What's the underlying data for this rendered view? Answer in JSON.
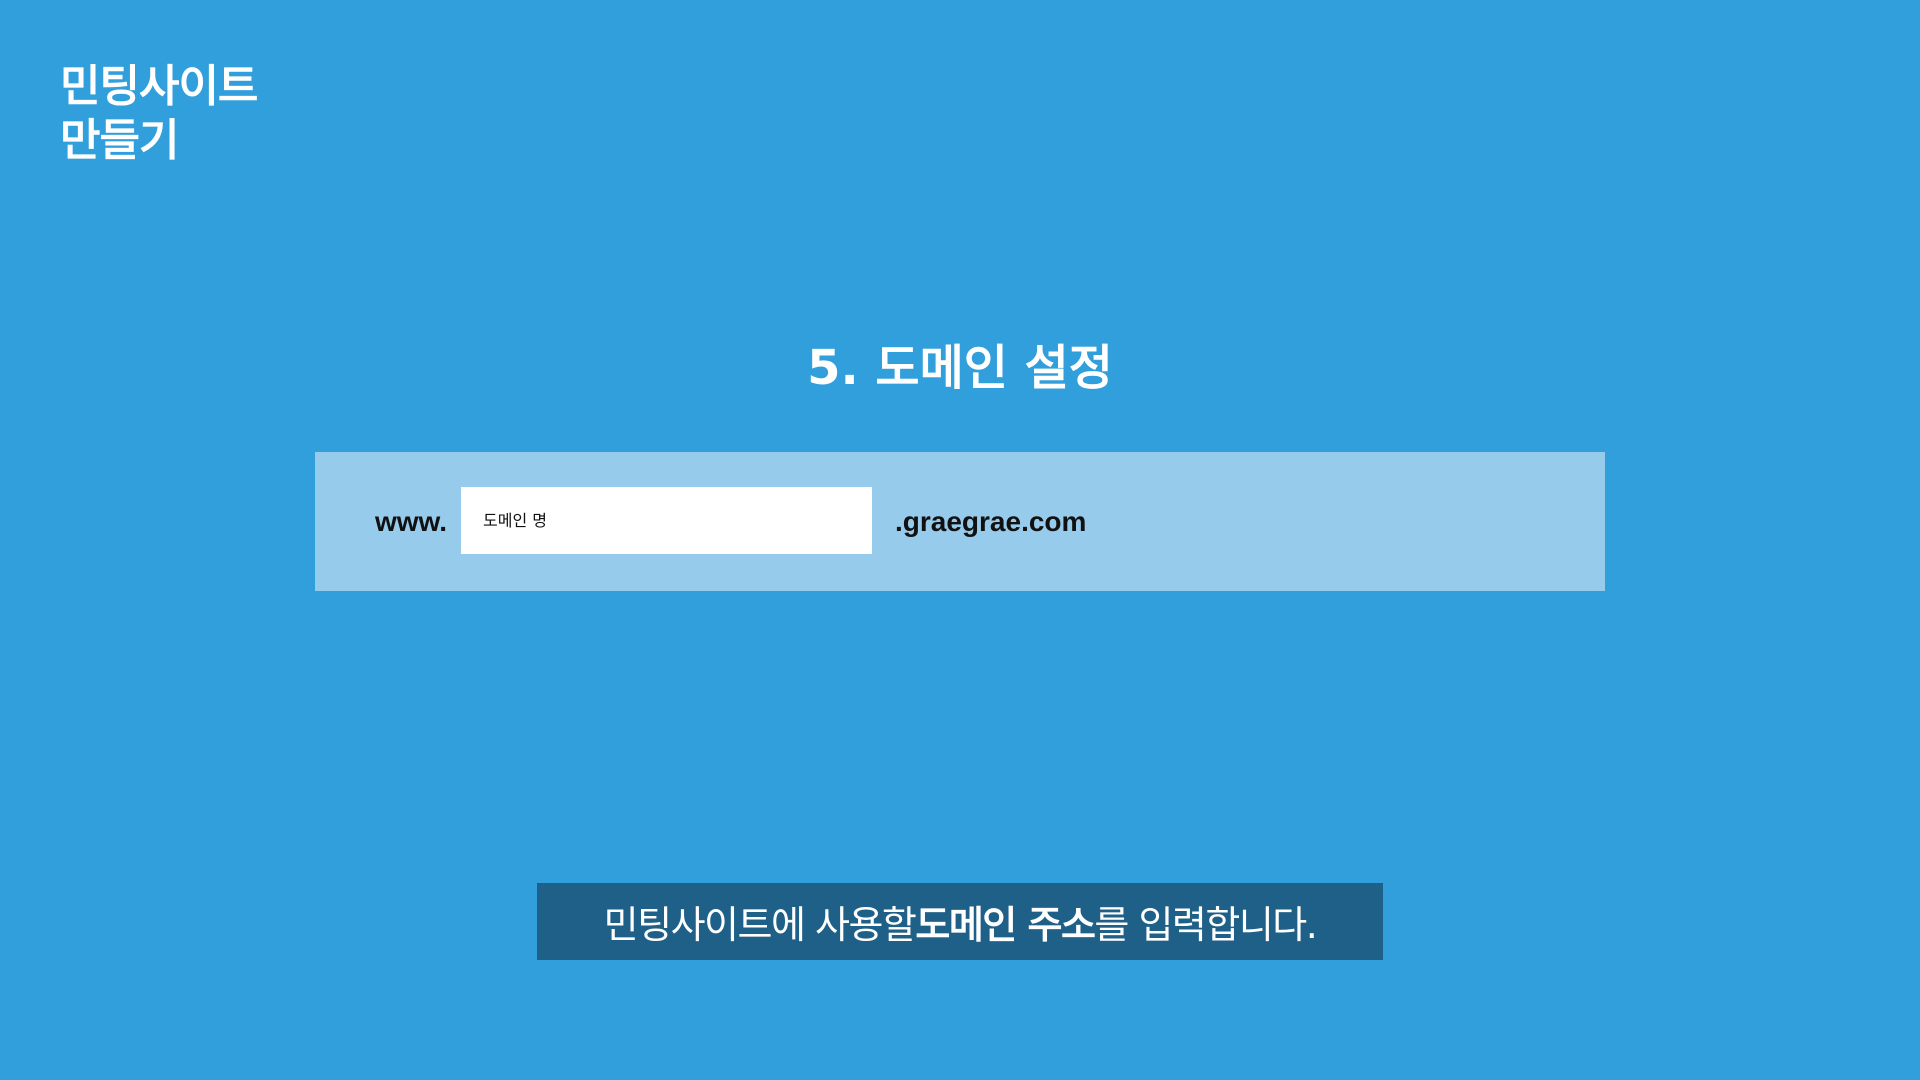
{
  "logo": {
    "line1": "민팅사이트",
    "line2": "만들기"
  },
  "step_title": "5. 도메인 설정",
  "domain_form": {
    "prefix": "www.",
    "input_placeholder": "도메인 명",
    "input_value": "",
    "suffix": ".graegrae.com"
  },
  "caption": {
    "part1": "민팅사이트에 사용할 ",
    "emphasis": "도메인 주소",
    "part2": "를 입력합니다."
  },
  "colors": {
    "background": "#319fdb",
    "panel": "#97cbeb",
    "caption_bg": "#1f6088",
    "text_light": "#ffffff",
    "text_dark": "#111111"
  }
}
